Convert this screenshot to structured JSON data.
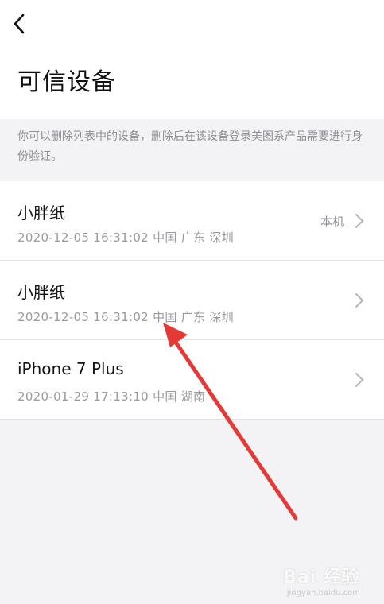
{
  "header": {
    "back_icon": "chevron-left-icon",
    "title": "可信设备"
  },
  "notice": {
    "text": "你可以删除列表中的设备，删除后在该设备登录美图系产品需要进行身份验证。"
  },
  "devices": [
    {
      "name": "小胖纸",
      "meta": "2020-12-05 16:31:02 中国 广东 深圳",
      "badge": "本机"
    },
    {
      "name": "小胖纸",
      "meta": "2020-12-05 16:31:02 中国 广东 深圳",
      "badge": ""
    },
    {
      "name": "iPhone 7 Plus",
      "meta": "2020-01-29 17:13:10 中国 湖南",
      "badge": ""
    }
  ],
  "annotation": {
    "arrow_color": "#e53935"
  },
  "watermark": {
    "text": "Bai 经验",
    "sub": "jingyan.baidu.com"
  },
  "colors": {
    "background": "#f3f3f5",
    "card": "#ffffff",
    "secondary_text": "#9a9a9f"
  }
}
